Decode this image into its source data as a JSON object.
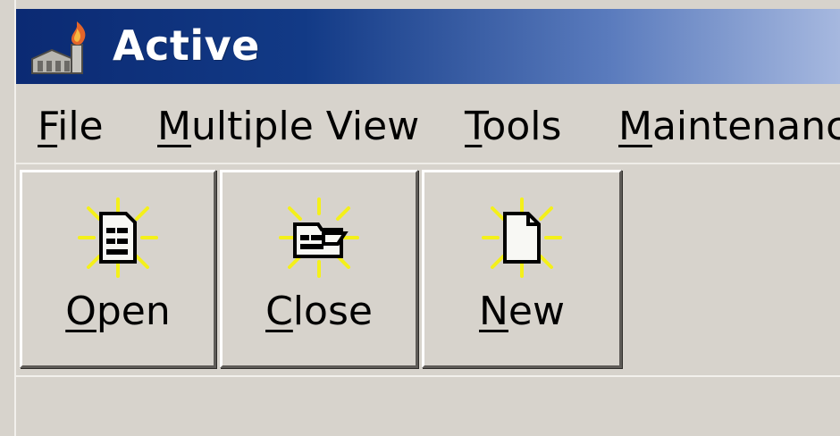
{
  "window": {
    "title": "Active",
    "app_icon": "building-flame-icon"
  },
  "menu": {
    "items": [
      {
        "mnemonic": "F",
        "rest": "ile"
      },
      {
        "mnemonic": "M",
        "rest": "ultiple View"
      },
      {
        "mnemonic": "T",
        "rest": "ools"
      },
      {
        "mnemonic": "M",
        "rest": "aintenanc"
      }
    ]
  },
  "toolbar": {
    "buttons": [
      {
        "mnemonic": "O",
        "rest": "pen",
        "icon": "open-document-icon"
      },
      {
        "mnemonic": "C",
        "rest": "lose",
        "icon": "close-folder-icon"
      },
      {
        "mnemonic": "N",
        "rest": "ew",
        "icon": "new-document-icon"
      }
    ]
  },
  "colors": {
    "titlebar_start": "#0b2a73",
    "titlebar_end": "#a6b8df",
    "face": "#d7d3cc",
    "icon_glow": "#f4f01a"
  }
}
